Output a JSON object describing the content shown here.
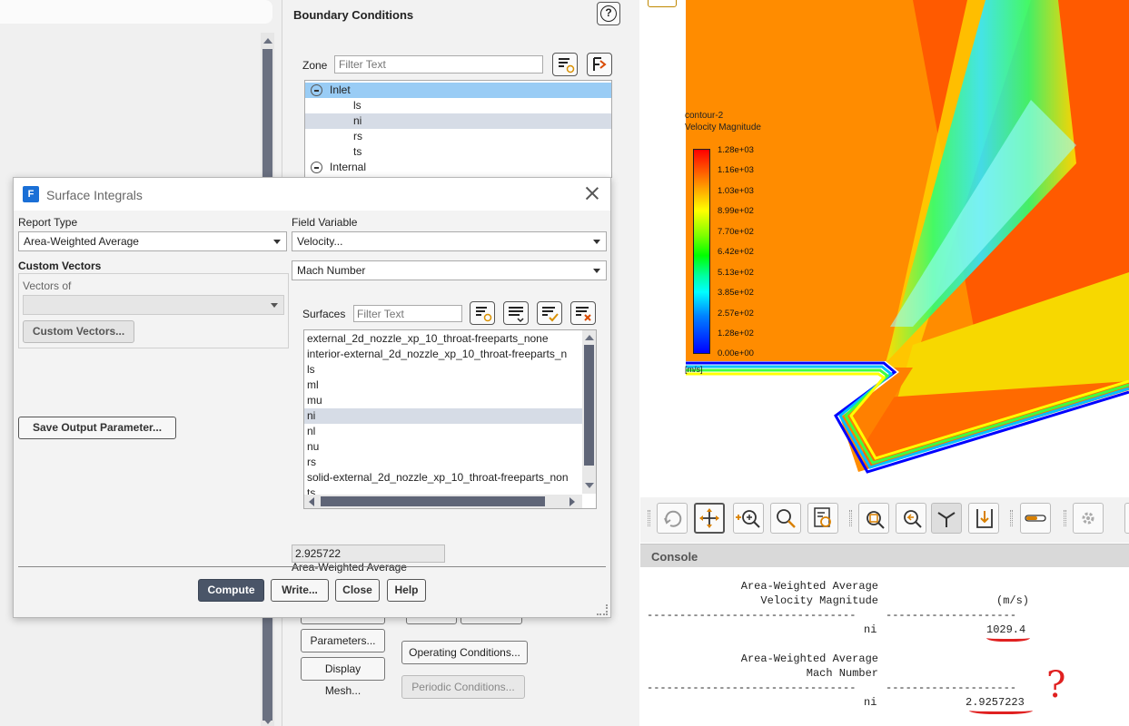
{
  "boundary_conditions": {
    "title": "Boundary Conditions",
    "help": "?",
    "zone_label": "Zone",
    "zone_filter_placeholder": "Filter Text",
    "tree": [
      {
        "label": "Inlet",
        "group": true
      },
      {
        "label": "ls"
      },
      {
        "label": "ni"
      },
      {
        "label": "rs"
      },
      {
        "label": "ts"
      },
      {
        "label": "Internal",
        "group": true
      }
    ],
    "buttons": {
      "parameters": "Parameters...",
      "display_mesh": "Display Mesh...",
      "operating_conditions": "Operating Conditions...",
      "periodic_conditions": "Periodic Conditions..."
    }
  },
  "viewport": {
    "legend_title": "contour-2",
    "legend_subtitle": "Velocity Magnitude",
    "legend_ticks": [
      "1.28e+03",
      "1.16e+03",
      "1.03e+03",
      "8.99e+02",
      "7.70e+02",
      "6.42e+02",
      "5.13e+02",
      "3.85e+02",
      "2.57e+02",
      "1.28e+02",
      "0.00e+00"
    ],
    "legend_unit": "[m/s]",
    "colors": {
      "max": "#ff0000",
      "min": "#0000ff",
      "background_flow": "#ff8c00"
    }
  },
  "console": {
    "title": "Console",
    "block1": {
      "header1": "Area-Weighted Average",
      "header2": "Velocity Magnitude",
      "unit": "(m/s)",
      "row_label": "ni",
      "value": "1029.4"
    },
    "block2": {
      "header1": "Area-Weighted Average",
      "header2": "Mach Number",
      "row_label": "ni",
      "value": "2.9257223"
    },
    "dashes_left": "--------------------------------",
    "dashes_right": "--------------------",
    "annotation": "?"
  },
  "dialog": {
    "title": "Surface Integrals",
    "logo": "F",
    "report_type_label": "Report Type",
    "report_type_value": "Area-Weighted Average",
    "custom_vectors_label": "Custom Vectors",
    "vectors_of_label": "Vectors of",
    "vectors_of_value": "",
    "custom_vectors_button": "Custom Vectors...",
    "save_output_button": "Save Output Parameter...",
    "field_variable_label": "Field Variable",
    "field_variable_value": "Velocity...",
    "field_sub_value": "Mach Number",
    "surfaces_label": "Surfaces",
    "surfaces_filter_placeholder": "Filter Text",
    "surfaces": [
      "external_2d_nozzle_xp_10_throat-freeparts_none",
      "interior-external_2d_nozzle_xp_10_throat-freeparts_n",
      "ls",
      "ml",
      "mu",
      "ni",
      "nl",
      "nu",
      "rs",
      "solid-external_2d_nozzle_xp_10_throat-freeparts_non",
      "ts"
    ],
    "selected_surface": "ni",
    "result_label": "Area-Weighted Average",
    "result_value": "2.925722",
    "buttons": {
      "compute": "Compute",
      "write": "Write...",
      "close": "Close",
      "help": "Help"
    }
  }
}
